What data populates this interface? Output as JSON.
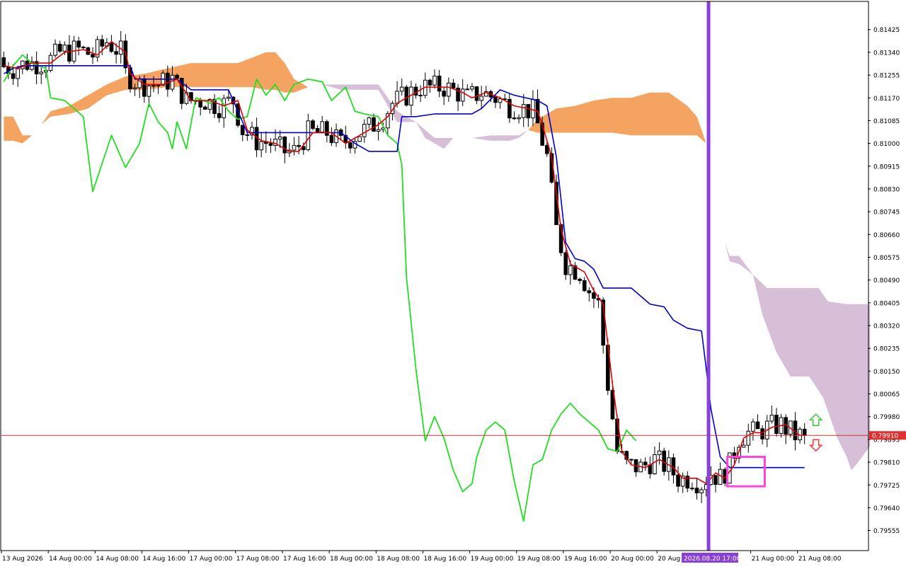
{
  "colors": {
    "background": "#ffffff",
    "frame": "#000000",
    "bull_candle": "#ffffff",
    "bear_candle": "#000000",
    "candle_outline": "#000000",
    "tenkan": "#e00000",
    "kijun": "#0000cc",
    "chikou": "#22dd22",
    "cloud_bullish": "#f4a460",
    "cloud_bearish": "#d8bfd8",
    "price_line": "#d03030",
    "price_label_bg": "#e03030",
    "current_time_line": "#8a3fd6",
    "time_label_bg": "#8a3fd6",
    "highlight_box": "#ff44dd",
    "arrow_up": "#33cc33",
    "arrow_down": "#ff3333",
    "kijun_highlight": "#1a5fb4"
  },
  "chart_data": {
    "type": "candlestick",
    "y_axis": {
      "min": 0.7948,
      "max": 0.8153,
      "ticks": [
        "0.81425",
        "0.81340",
        "0.81255",
        "0.81170",
        "0.81085",
        "0.81000",
        "0.80915",
        "0.80830",
        "0.80745",
        "0.80660",
        "0.80575",
        "0.80490",
        "0.80405",
        "0.80320",
        "0.80235",
        "0.80150",
        "0.80065",
        "0.79980",
        "0.79895",
        "0.79810",
        "0.79725",
        "0.79640",
        "0.79555"
      ]
    },
    "x_axis": {
      "bars_total": 185,
      "labels": [
        {
          "text": "13 Aug 2026",
          "bar": 0
        },
        {
          "text": "14 Aug 00:00",
          "bar": 10
        },
        {
          "text": "14 Aug 08:00",
          "bar": 20
        },
        {
          "text": "14 Aug 16:00",
          "bar": 30
        },
        {
          "text": "17 Aug 00:00",
          "bar": 40
        },
        {
          "text": "17 Aug 08:00",
          "bar": 50
        },
        {
          "text": "17 Aug 16:00",
          "bar": 60
        },
        {
          "text": "18 Aug 00:00",
          "bar": 70
        },
        {
          "text": "18 Aug 08:00",
          "bar": 80
        },
        {
          "text": "18 Aug 16:00",
          "bar": 90
        },
        {
          "text": "19 Aug 00:00",
          "bar": 100
        },
        {
          "text": "19 Aug 08:00",
          "bar": 110
        },
        {
          "text": "19 Aug 16:00",
          "bar": 120
        },
        {
          "text": "20 Aug 00:00",
          "bar": 130
        },
        {
          "text": "20 Aug",
          "bar": 140
        },
        {
          "text": "21 Aug 00:00",
          "bar": 160
        },
        {
          "text": "21 Aug 08:00",
          "bar": 170
        }
      ],
      "current_time_label": "2026.08.20 17:00",
      "current_time_bar": 150.5
    },
    "current_price": {
      "value": 0.7991,
      "label": "0.79910"
    },
    "tenkan_points": [
      [
        0,
        0.8129
      ],
      [
        3,
        0.8128
      ],
      [
        6,
        0.813
      ],
      [
        10,
        0.813
      ],
      [
        13,
        0.8134
      ],
      [
        17,
        0.8135
      ],
      [
        20,
        0.8133
      ],
      [
        23,
        0.8138
      ],
      [
        26,
        0.8134
      ],
      [
        27,
        0.8126
      ],
      [
        30,
        0.8122
      ],
      [
        34,
        0.8122
      ],
      [
        37,
        0.8124
      ],
      [
        40,
        0.8116
      ],
      [
        44,
        0.8116
      ],
      [
        47,
        0.8114
      ],
      [
        50,
        0.8116
      ],
      [
        52,
        0.8105
      ],
      [
        55,
        0.8101
      ],
      [
        58,
        0.81
      ],
      [
        61,
        0.8097
      ],
      [
        63,
        0.8097
      ],
      [
        66,
        0.8104
      ],
      [
        70,
        0.8104
      ],
      [
        73,
        0.81
      ],
      [
        76,
        0.8103
      ],
      [
        80,
        0.8107
      ],
      [
        82,
        0.811
      ],
      [
        84,
        0.8115
      ],
      [
        87,
        0.8118
      ],
      [
        90,
        0.8121
      ],
      [
        95,
        0.8121
      ],
      [
        98,
        0.8119
      ],
      [
        100,
        0.8117
      ],
      [
        103,
        0.8119
      ],
      [
        106,
        0.8117
      ],
      [
        109,
        0.8114
      ],
      [
        112,
        0.8113
      ],
      [
        114,
        0.8112
      ],
      [
        115,
        0.8107
      ],
      [
        117,
        0.8095
      ],
      [
        119,
        0.8068
      ],
      [
        121,
        0.8055
      ],
      [
        124,
        0.8052
      ],
      [
        126,
        0.8045
      ],
      [
        128,
        0.804
      ],
      [
        130,
        0.801
      ],
      [
        132,
        0.7985
      ],
      [
        134,
        0.798
      ],
      [
        137,
        0.7979
      ],
      [
        140,
        0.7982
      ],
      [
        143,
        0.7979
      ],
      [
        145,
        0.7975
      ],
      [
        148,
        0.7975
      ],
      [
        150,
        0.7973
      ],
      [
        152,
        0.7977
      ],
      [
        154,
        0.7975
      ],
      [
        156,
        0.798
      ],
      [
        158,
        0.799
      ],
      [
        160,
        0.7992
      ],
      [
        162,
        0.7992
      ],
      [
        164,
        0.7994
      ],
      [
        167,
        0.7995
      ],
      [
        170,
        0.7991
      ],
      [
        171,
        0.7991
      ]
    ],
    "kijun_points": [
      [
        0,
        0.8126
      ],
      [
        2,
        0.8128
      ],
      [
        4,
        0.8129
      ],
      [
        27,
        0.8129
      ],
      [
        28,
        0.8124
      ],
      [
        37,
        0.8124
      ],
      [
        40,
        0.812
      ],
      [
        44,
        0.812
      ],
      [
        48,
        0.812
      ],
      [
        52,
        0.8104
      ],
      [
        60,
        0.8104
      ],
      [
        68,
        0.8104
      ],
      [
        72,
        0.8104
      ],
      [
        75,
        0.81
      ],
      [
        78,
        0.8097
      ],
      [
        84,
        0.8097
      ],
      [
        85,
        0.811
      ],
      [
        88,
        0.811
      ],
      [
        92,
        0.8111
      ],
      [
        96,
        0.8111
      ],
      [
        100,
        0.8111
      ],
      [
        102,
        0.8113
      ],
      [
        106,
        0.812
      ],
      [
        109,
        0.8118
      ],
      [
        114,
        0.8116
      ],
      [
        116,
        0.8114
      ],
      [
        118,
        0.8095
      ],
      [
        120,
        0.8063
      ],
      [
        122,
        0.8057
      ],
      [
        124,
        0.8056
      ],
      [
        126,
        0.8053
      ],
      [
        128,
        0.8046
      ],
      [
        134,
        0.8046
      ],
      [
        136,
        0.8043
      ],
      [
        138,
        0.804
      ],
      [
        141,
        0.8039
      ],
      [
        143,
        0.8034
      ],
      [
        146,
        0.8031
      ],
      [
        149,
        0.803
      ],
      [
        150,
        0.8016
      ],
      [
        151,
        0.8001
      ],
      [
        153,
        0.7983
      ],
      [
        155,
        0.7979
      ],
      [
        158,
        0.7979
      ],
      [
        171,
        0.7979
      ]
    ],
    "chikou_points": [
      [
        0,
        0.8123
      ],
      [
        2,
        0.8129
      ],
      [
        4,
        0.8133
      ],
      [
        6,
        0.813
      ],
      [
        9,
        0.8128
      ],
      [
        10,
        0.8117
      ],
      [
        13,
        0.8116
      ],
      [
        17,
        0.811
      ],
      [
        19,
        0.8082
      ],
      [
        23,
        0.8103
      ],
      [
        26,
        0.8091
      ],
      [
        29,
        0.81
      ],
      [
        31,
        0.8115
      ],
      [
        33,
        0.8108
      ],
      [
        35,
        0.8104
      ],
      [
        36,
        0.8098
      ],
      [
        37,
        0.8108
      ],
      [
        39,
        0.8098
      ],
      [
        41,
        0.8117
      ],
      [
        44,
        0.8115
      ],
      [
        46,
        0.8117
      ],
      [
        48,
        0.8112
      ],
      [
        50,
        0.8109
      ],
      [
        52,
        0.811
      ],
      [
        54,
        0.8124
      ],
      [
        56,
        0.8118
      ],
      [
        58,
        0.8122
      ],
      [
        60,
        0.8116
      ],
      [
        62,
        0.8122
      ],
      [
        65,
        0.8124
      ],
      [
        68,
        0.8123
      ],
      [
        70,
        0.8116
      ],
      [
        73,
        0.8121
      ],
      [
        75,
        0.8112
      ],
      [
        77,
        0.8111
      ],
      [
        80,
        0.811
      ],
      [
        82,
        0.8103
      ],
      [
        84,
        0.81
      ],
      [
        85,
        0.8092
      ],
      [
        86,
        0.805
      ],
      [
        88,
        0.8016
      ],
      [
        90,
        0.7989
      ],
      [
        92,
        0.7998
      ],
      [
        94,
        0.799
      ],
      [
        96,
        0.7978
      ],
      [
        98,
        0.797
      ],
      [
        100,
        0.7973
      ],
      [
        101,
        0.7983
      ],
      [
        103,
        0.7993
      ],
      [
        105,
        0.7996
      ],
      [
        107,
        0.7993
      ],
      [
        109,
        0.7974
      ],
      [
        111,
        0.7959
      ],
      [
        113,
        0.798
      ],
      [
        115,
        0.7982
      ],
      [
        117,
        0.7993
      ],
      [
        119,
        0.7999
      ],
      [
        121,
        0.8003
      ],
      [
        123,
        0.7999
      ],
      [
        125,
        0.7996
      ],
      [
        127,
        0.7993
      ],
      [
        129,
        0.7986
      ],
      [
        131,
        0.7985
      ],
      [
        133,
        0.7993
      ],
      [
        135,
        0.7989
      ]
    ],
    "cloud_segments": [
      {
        "kind": "bullish",
        "span_a": [
          [
            0,
            0.811
          ],
          [
            2,
            0.811
          ],
          [
            4,
            0.8103
          ],
          [
            6,
            0.8103
          ],
          [
            8,
            0.8107
          ],
          [
            10,
            0.8112
          ],
          [
            14,
            0.8114
          ],
          [
            18,
            0.8118
          ],
          [
            22,
            0.8122
          ],
          [
            26,
            0.8125
          ],
          [
            30,
            0.8126
          ],
          [
            35,
            0.8128
          ],
          [
            40,
            0.813
          ],
          [
            45,
            0.813
          ],
          [
            50,
            0.813
          ],
          [
            53,
            0.8132
          ],
          [
            56,
            0.8134
          ],
          [
            58,
            0.8134
          ],
          [
            60,
            0.813
          ],
          [
            62,
            0.8124
          ],
          [
            65,
            0.8121
          ],
          [
            68,
            0.8122
          ]
        ],
        "span_b": [
          [
            0,
            0.8101
          ],
          [
            2,
            0.8101
          ],
          [
            4,
            0.81
          ],
          [
            6,
            0.8103
          ],
          [
            8,
            0.8107
          ],
          [
            10,
            0.811
          ],
          [
            14,
            0.8111
          ],
          [
            18,
            0.8113
          ],
          [
            22,
            0.8118
          ],
          [
            26,
            0.812
          ],
          [
            30,
            0.812
          ],
          [
            35,
            0.8121
          ],
          [
            40,
            0.8121
          ],
          [
            45,
            0.8121
          ],
          [
            50,
            0.8121
          ],
          [
            53,
            0.8121
          ],
          [
            56,
            0.812
          ],
          [
            58,
            0.812
          ],
          [
            60,
            0.8119
          ],
          [
            62,
            0.8119
          ],
          [
            65,
            0.8121
          ],
          [
            68,
            0.8122
          ]
        ]
      },
      {
        "kind": "bearish",
        "span_a": [
          [
            68,
            0.8122
          ],
          [
            72,
            0.8122
          ],
          [
            76,
            0.8122
          ],
          [
            80,
            0.8122
          ],
          [
            84,
            0.8112
          ],
          [
            88,
            0.8108
          ],
          [
            92,
            0.8102
          ],
          [
            96,
            0.8102
          ],
          [
            100,
            0.8102
          ],
          [
            104,
            0.8103
          ],
          [
            108,
            0.8103
          ],
          [
            110,
            0.8103
          ],
          [
            112,
            0.8105
          ]
        ],
        "span_b": [
          [
            68,
            0.8122
          ],
          [
            72,
            0.812
          ],
          [
            76,
            0.812
          ],
          [
            80,
            0.812
          ],
          [
            84,
            0.8108
          ],
          [
            88,
            0.8108
          ],
          [
            90,
            0.8102
          ],
          [
            92,
            0.81
          ],
          [
            94,
            0.8098
          ],
          [
            96,
            0.8102
          ],
          [
            100,
            0.8102
          ],
          [
            104,
            0.8101
          ],
          [
            108,
            0.8101
          ],
          [
            110,
            0.8102
          ],
          [
            112,
            0.8105
          ]
        ]
      },
      {
        "kind": "bullish",
        "span_a": [
          [
            112,
            0.8105
          ],
          [
            114,
            0.8109
          ],
          [
            118,
            0.8113
          ],
          [
            122,
            0.8114
          ],
          [
            126,
            0.8116
          ],
          [
            130,
            0.8117
          ],
          [
            134,
            0.8117
          ],
          [
            138,
            0.8119
          ],
          [
            142,
            0.8119
          ],
          [
            146,
            0.8114
          ],
          [
            148,
            0.811
          ],
          [
            150,
            0.81
          ]
        ],
        "span_b": [
          [
            112,
            0.8105
          ],
          [
            114,
            0.8104
          ],
          [
            118,
            0.8104
          ],
          [
            122,
            0.8104
          ],
          [
            126,
            0.8104
          ],
          [
            130,
            0.8104
          ],
          [
            134,
            0.8103
          ],
          [
            138,
            0.8103
          ],
          [
            142,
            0.8103
          ],
          [
            146,
            0.8103
          ],
          [
            148,
            0.8103
          ],
          [
            150,
            0.81
          ]
        ]
      },
      {
        "kind": "bearish",
        "span_a": [
          [
            150,
            0.81
          ],
          [
            152,
            0.808
          ],
          [
            154,
            0.8063
          ],
          [
            155,
            0.8058
          ],
          [
            157,
            0.8058
          ],
          [
            160,
            0.8051
          ],
          [
            163,
            0.8046
          ],
          [
            166,
            0.8046
          ],
          [
            170,
            0.8046
          ],
          [
            174,
            0.8046
          ],
          [
            176,
            0.8041
          ],
          [
            180,
            0.804
          ],
          [
            185,
            0.804
          ]
        ],
        "span_b": [
          [
            150,
            0.81
          ],
          [
            152,
            0.808
          ],
          [
            154,
            0.8063
          ],
          [
            155,
            0.8056
          ],
          [
            157,
            0.8055
          ],
          [
            160,
            0.8051
          ],
          [
            162,
            0.8036
          ],
          [
            165,
            0.8022
          ],
          [
            168,
            0.8013
          ],
          [
            172,
            0.8013
          ],
          [
            175,
            0.8005
          ],
          [
            178,
            0.799
          ],
          [
            180,
            0.7983
          ],
          [
            181,
            0.7978
          ],
          [
            182,
            0.798
          ],
          [
            185,
            0.7987
          ]
        ]
      }
    ],
    "highlight_box": {
      "bar_start": 154.5,
      "bar_end": 162.5,
      "price_high": 0.7983,
      "price_low": 0.7972
    }
  }
}
